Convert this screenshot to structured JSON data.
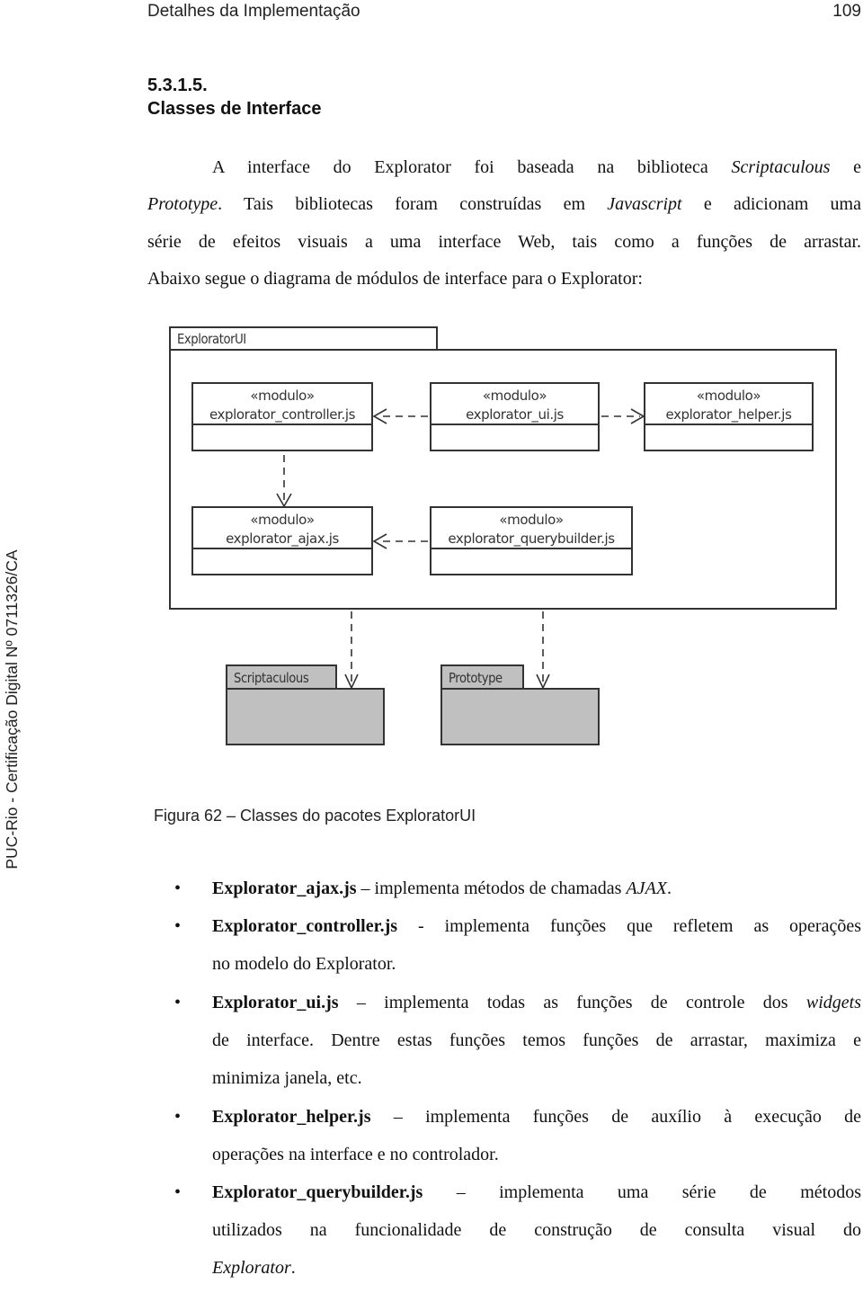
{
  "header": {
    "running_title": "Detalhes da Implementação",
    "page_number": "109"
  },
  "section": {
    "number": "5.3.1.5.",
    "title": "Classes de Interface"
  },
  "intro": {
    "line1_a": "A interface do Explorator foi baseada na biblioteca ",
    "line1_i": "Scriptaculous",
    "line1_b": " e",
    "line2_i1": "Prototype",
    "line2_a": ". Tais bibliotecas foram construídas em ",
    "line2_i2": "Javascript",
    "line2_b": " e adicionam uma",
    "line3": "série de efeitos visuais a uma interface Web, tais como a funções de arrastar.",
    "line4": "Abaixo segue o diagrama de módulos de interface para o Explorator:"
  },
  "sidebar_stamp": "PUC-Rio - Certificação Digital Nº 0711326/CA",
  "diagram": {
    "package_name": "ExploratorUI",
    "stereotype": "«modulo»",
    "modules": [
      {
        "id": "controller",
        "name": "explorator_controller.js"
      },
      {
        "id": "ui",
        "name": "explorator_ui.js"
      },
      {
        "id": "helper",
        "name": "explorator_helper.js"
      },
      {
        "id": "ajax",
        "name": "explorator_ajax.js"
      },
      {
        "id": "querybuilder",
        "name": "explorator_querybuilder.js"
      }
    ],
    "external_packages": [
      {
        "id": "scriptaculous",
        "name": "Scriptaculous"
      },
      {
        "id": "prototype",
        "name": "Prototype"
      }
    ],
    "dependencies": [
      {
        "from": "explorator_ui.js",
        "to": "explorator_controller.js"
      },
      {
        "from": "explorator_ui.js",
        "to": "explorator_helper.js"
      },
      {
        "from": "explorator_controller.js",
        "to": "explorator_ajax.js"
      },
      {
        "from": "explorator_querybuilder.js",
        "to": "explorator_ajax.js"
      },
      {
        "from": "ExploratorUI",
        "to": "Scriptaculous"
      },
      {
        "from": "ExploratorUI",
        "to": "Prototype"
      }
    ],
    "colors": {
      "line": "#333333",
      "external_fill": "#c0c0c0"
    }
  },
  "figure_caption": "Figura 62 – Classes do pacotes ExploratorUI",
  "bullets": [
    {
      "bold": "Explorator_ajax.js",
      "l1": " – implementa métodos de chamadas ",
      "l1_i": "AJAX",
      "l1_end": "."
    },
    {
      "bold": "Explorator_controller.js",
      "l1": " - implementa funções que refletem as operações",
      "l2": "no modelo do Explorator."
    },
    {
      "bold": "Explorator_ui.js",
      "l1": " – implementa todas as funções de controle dos ",
      "l1_i": "widgets",
      "l2": "de interface. Dentre estas funções temos funções de arrastar, maximiza e",
      "l3": "minimiza janela, etc."
    },
    {
      "bold": "Explorator_helper.js",
      "l1": " – implementa funções de auxílio à execução de",
      "l2": "operações na interface e no controlador."
    },
    {
      "bold": "Explorator_querybuilder.js",
      "l1": " – implementa uma série de métodos",
      "l2": "utilizados na funcionalidade de construção de consulta visual do",
      "l3_i": "Explorator",
      "l3_end": "."
    }
  ]
}
